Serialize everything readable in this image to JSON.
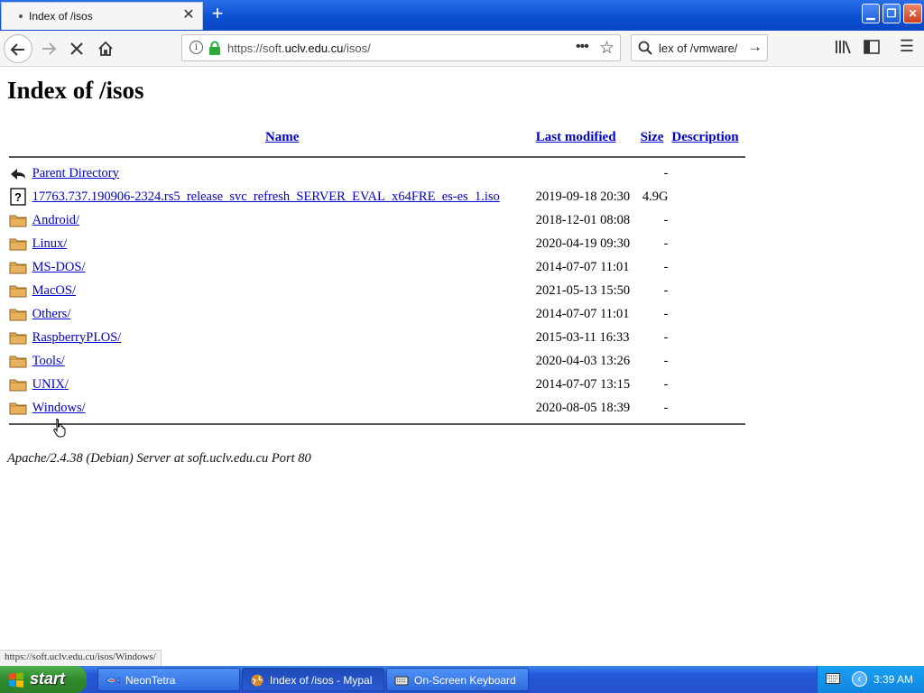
{
  "browser": {
    "tab_title": "Index of /isos",
    "tab_close": "✕",
    "new_tab": "+",
    "url_prefix": "https://soft.",
    "url_domain": "uclv.edu.cu",
    "url_suffix": "/isos/",
    "search_text": "lex of /vmware/",
    "status_link": "https://soft.uclv.edu.cu/isos/Windows/"
  },
  "page": {
    "title": "Index of /isos",
    "columns": {
      "name": "Name",
      "modified": "Last modified",
      "size": "Size",
      "description": "Description"
    },
    "parent": {
      "name": "Parent Directory",
      "size": "-"
    },
    "rows": [
      {
        "name": "17763.737.190906-2324.rs5_release_svc_refresh_SERVER_EVAL_x64FRE_es-es_1.iso",
        "modified": "2019-09-18 20:30",
        "size": "4.9G",
        "type": "file"
      },
      {
        "name": "Android/",
        "modified": "2018-12-01 08:08",
        "size": "-",
        "type": "folder"
      },
      {
        "name": "Linux/",
        "modified": "2020-04-19 09:30",
        "size": "-",
        "type": "folder"
      },
      {
        "name": "MS-DOS/",
        "modified": "2014-07-07 11:01",
        "size": "-",
        "type": "folder"
      },
      {
        "name": "MacOS/",
        "modified": "2021-05-13 15:50",
        "size": "-",
        "type": "folder"
      },
      {
        "name": "Others/",
        "modified": "2014-07-07 11:01",
        "size": "-",
        "type": "folder"
      },
      {
        "name": "RaspberryPI.OS/",
        "modified": "2015-03-11 16:33",
        "size": "-",
        "type": "folder"
      },
      {
        "name": "Tools/",
        "modified": "2020-04-03 13:26",
        "size": "-",
        "type": "folder"
      },
      {
        "name": "UNIX/",
        "modified": "2014-07-07 13:15",
        "size": "-",
        "type": "folder"
      },
      {
        "name": "Windows/",
        "modified": "2020-08-05 18:39",
        "size": "-",
        "type": "folder"
      }
    ],
    "footer": "Apache/2.4.38 (Debian) Server at soft.uclv.edu.cu Port 80"
  },
  "taskbar": {
    "start_label": "start",
    "tasks": [
      {
        "label": "NeonTetra"
      },
      {
        "label": "Index of /isos - Mypal"
      },
      {
        "label": "On-Screen Keyboard"
      }
    ],
    "clock": "3:39 AM"
  },
  "colors": {
    "link": "#0000cc",
    "taskbar": "#2451cc",
    "start": "#2f8a2e"
  }
}
